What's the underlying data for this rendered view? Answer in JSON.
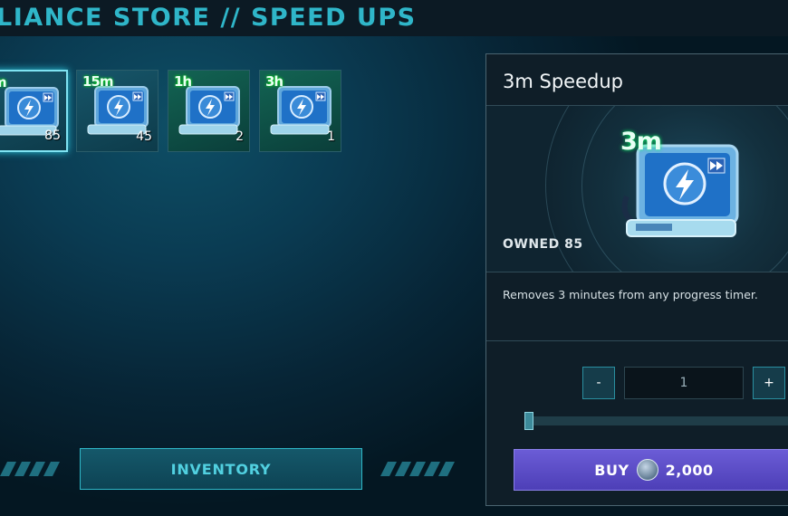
{
  "header": {
    "title": "LIANCE STORE // SPEED UPS"
  },
  "items": [
    {
      "duration": "m",
      "quantity": "85",
      "selected": true
    },
    {
      "duration": "15m",
      "quantity": "45",
      "selected": false
    },
    {
      "duration": "1h",
      "quantity": "2",
      "selected": false
    },
    {
      "duration": "3h",
      "quantity": "1",
      "selected": false
    }
  ],
  "inventory_button": {
    "label": "INVENTORY"
  },
  "detail": {
    "title": "3m Speedup",
    "preview_duration": "3m",
    "owned": "OWNED 85",
    "description": "Removes 3 minutes from any progress timer.",
    "decrement_label": "-",
    "increment_label": "+",
    "quantity_value": "1",
    "slider_value": 1,
    "buy_label": "BUY",
    "price": "2,000"
  },
  "colors": {
    "accent": "#2fb6c9",
    "buy": "#5c4dc9",
    "selected_border": "#7fe3f2"
  },
  "icons": [
    "speedup-tablet-icon",
    "lightning-icon",
    "fast-forward-icon",
    "coin-icon"
  ]
}
